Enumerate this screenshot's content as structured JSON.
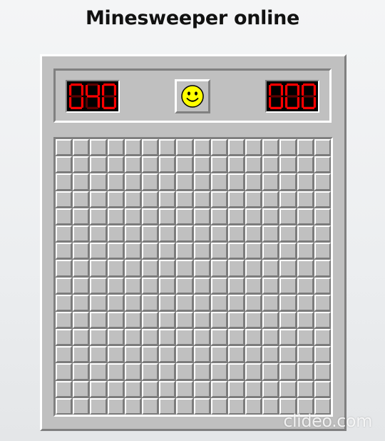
{
  "page": {
    "title": "Minesweeper online"
  },
  "game": {
    "mine_counter": "040",
    "timer": "000",
    "face_state": "smiley-face-icon",
    "rows": 16,
    "cols": 16,
    "cell_state": "unrevealed"
  },
  "colors": {
    "panel": "#c0c0c0",
    "bevel_light": "#ffffff",
    "bevel_dark": "#808080",
    "led_on": "#ff0000",
    "led_off": "#5a0000",
    "face": "#ffff00"
  },
  "watermark": "clideo.com"
}
